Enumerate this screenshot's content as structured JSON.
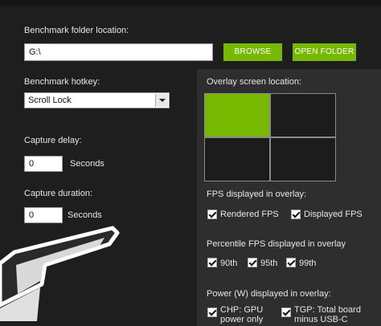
{
  "folder": {
    "label": "Benchmark folder location:",
    "value": "G:\\",
    "browse_label": "BROWSE",
    "open_label": "OPEN FOLDER"
  },
  "hotkey": {
    "label": "Benchmark hotkey:",
    "selected": "Scroll Lock"
  },
  "capture_delay": {
    "label": "Capture delay:",
    "value": "0",
    "unit": "Seconds"
  },
  "capture_duration": {
    "label": "Capture duration:",
    "value": "0",
    "unit": "Seconds"
  },
  "overlay": {
    "location_label": "Overlay screen location:",
    "selected_cell": "top-left",
    "fps_label": "FPS displayed in overlay:",
    "fps_options": [
      {
        "label": "Rendered FPS",
        "checked": true
      },
      {
        "label": "Displayed FPS",
        "checked": true
      }
    ],
    "percentile_label": "Percentile FPS displayed in overlay",
    "percentile_options": [
      {
        "label": "90th",
        "checked": true
      },
      {
        "label": "95th",
        "checked": true
      },
      {
        "label": "99th",
        "checked": true
      }
    ],
    "power_label": "Power (W) displayed in overlay:",
    "power_options": [
      {
        "line1": "CHP: GPU",
        "line2": "power only",
        "checked": true
      },
      {
        "line1": "TGP: Total board",
        "line2": "minus USB-C",
        "checked": true
      }
    ]
  },
  "colors": {
    "accent": "#76b900",
    "background": "#1e1e1e",
    "panel": "#2e2e2e"
  },
  "icons": {
    "logo": "brand-logo-icon"
  }
}
